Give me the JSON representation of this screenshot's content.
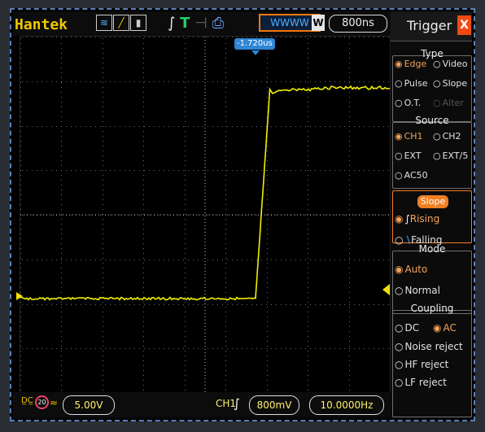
{
  "brand": "Hantek",
  "timebase": "800ns",
  "trigger_pos": "-1.720us",
  "topbar": {
    "w_label": "W"
  },
  "scope": {
    "waveform_level": "5.00V"
  },
  "bottom": {
    "ch_label": "CH1",
    "voltage": "800mV",
    "frequency": "10.0000Hz"
  },
  "trigger_panel": {
    "title": "Trigger",
    "close": "X",
    "type": {
      "label": "Type",
      "options": [
        {
          "label": "Edge",
          "selected": true
        },
        {
          "label": "Video",
          "selected": false
        },
        {
          "label": "Pulse",
          "selected": false
        },
        {
          "label": "Slope",
          "selected": false
        },
        {
          "label": "O.T.",
          "selected": false
        },
        {
          "label": "Alter",
          "selected": false
        }
      ]
    },
    "source": {
      "label": "Source",
      "options": [
        {
          "label": "CH1",
          "selected": true
        },
        {
          "label": "CH2",
          "selected": false
        },
        {
          "label": "EXT",
          "selected": false
        },
        {
          "label": "EXT/5",
          "selected": false
        },
        {
          "label": "AC50",
          "selected": false
        }
      ]
    },
    "slope": {
      "label": "Slope",
      "options": [
        {
          "label": "Rising",
          "selected": true
        },
        {
          "label": "Falling",
          "selected": false
        }
      ]
    },
    "mode": {
      "label": "Mode",
      "options": [
        {
          "label": "Auto",
          "selected": true
        },
        {
          "label": "Normal",
          "selected": false
        }
      ]
    },
    "coupling": {
      "label": "Coupling",
      "options": [
        {
          "label": "DC",
          "selected": false
        },
        {
          "label": "AC",
          "selected": true
        },
        {
          "label": "Noise reject",
          "selected": false
        },
        {
          "label": "HF reject",
          "selected": false
        },
        {
          "label": "LF reject",
          "selected": false
        }
      ]
    }
  }
}
